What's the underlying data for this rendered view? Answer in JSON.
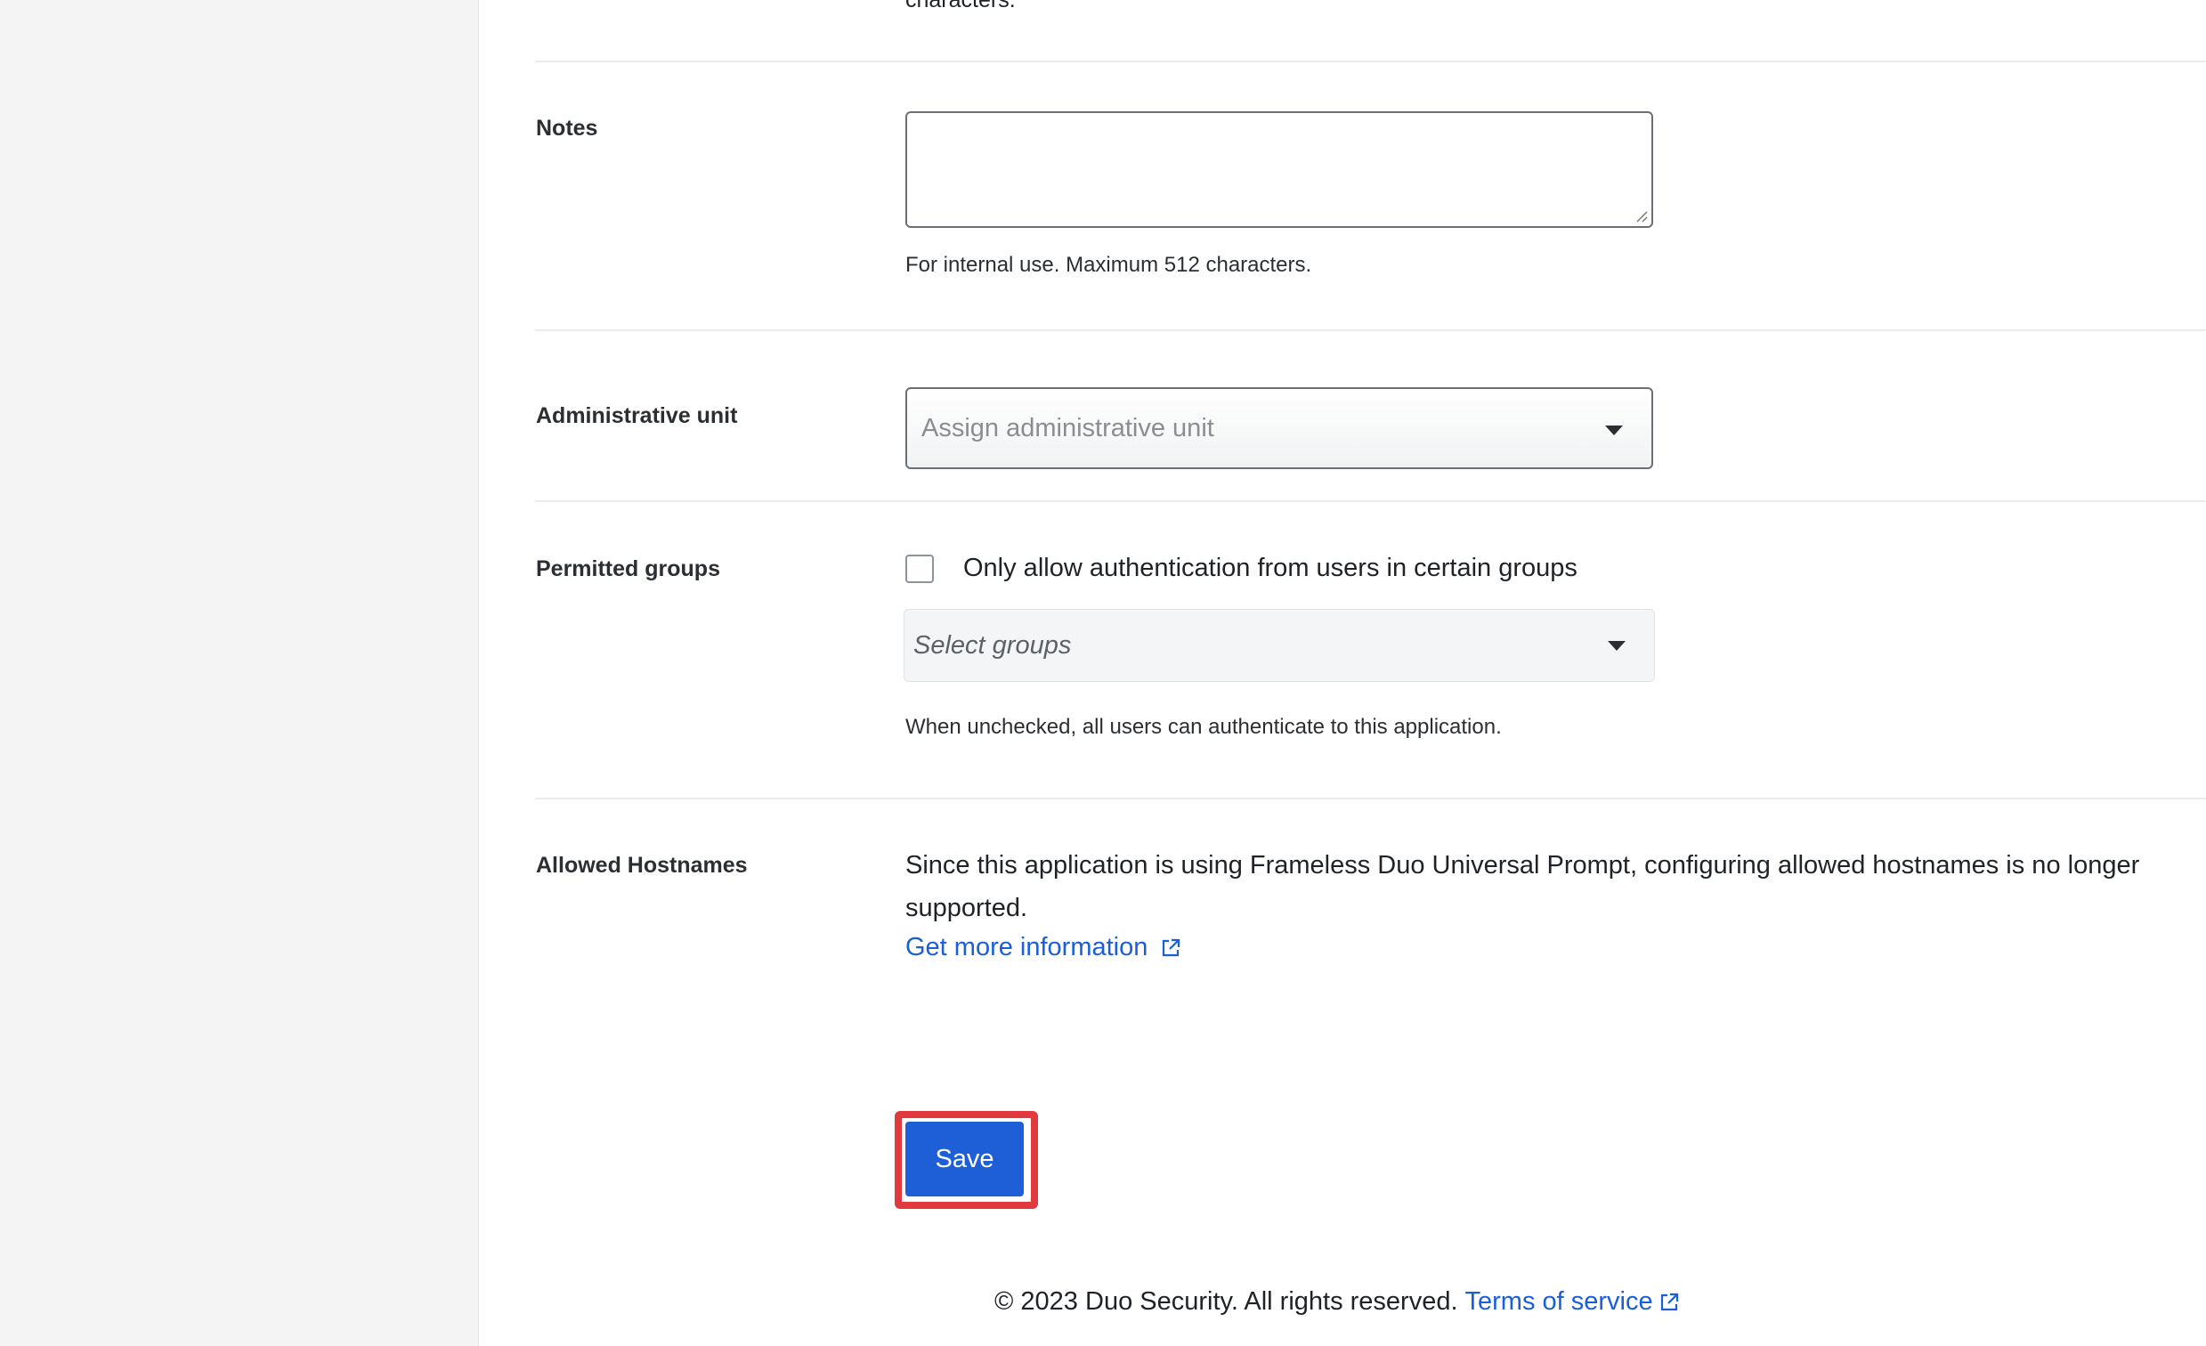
{
  "top_cut_text": "characters.",
  "notes": {
    "label": "Notes",
    "value": "",
    "help": "For internal use. Maximum 512 characters."
  },
  "admin_unit": {
    "label": "Administrative unit",
    "placeholder": "Assign administrative unit"
  },
  "permitted_groups": {
    "label": "Permitted groups",
    "checkbox_label": "Only allow authentication from users in certain groups",
    "checked": false,
    "select_placeholder": "Select groups",
    "help": "When unchecked, all users can authenticate to this application."
  },
  "allowed_hostnames": {
    "label": "Allowed Hostnames",
    "text": "Since this application is using Frameless Duo Universal Prompt, configuring allowed hostnames is no longer supported.",
    "link_text": "Get more information",
    "link_icon": "external-link-icon"
  },
  "save": {
    "label": "Save",
    "highlight_color": "#e0393e",
    "button_color": "#1e5fd8"
  },
  "footer": {
    "copyright": "© 2023 Duo Security. All rights reserved.",
    "terms_link": "Terms of service",
    "terms_icon": "external-link-icon"
  },
  "colors": {
    "link": "#1a5ed9",
    "sidebar_bg": "#f4f4f4"
  }
}
